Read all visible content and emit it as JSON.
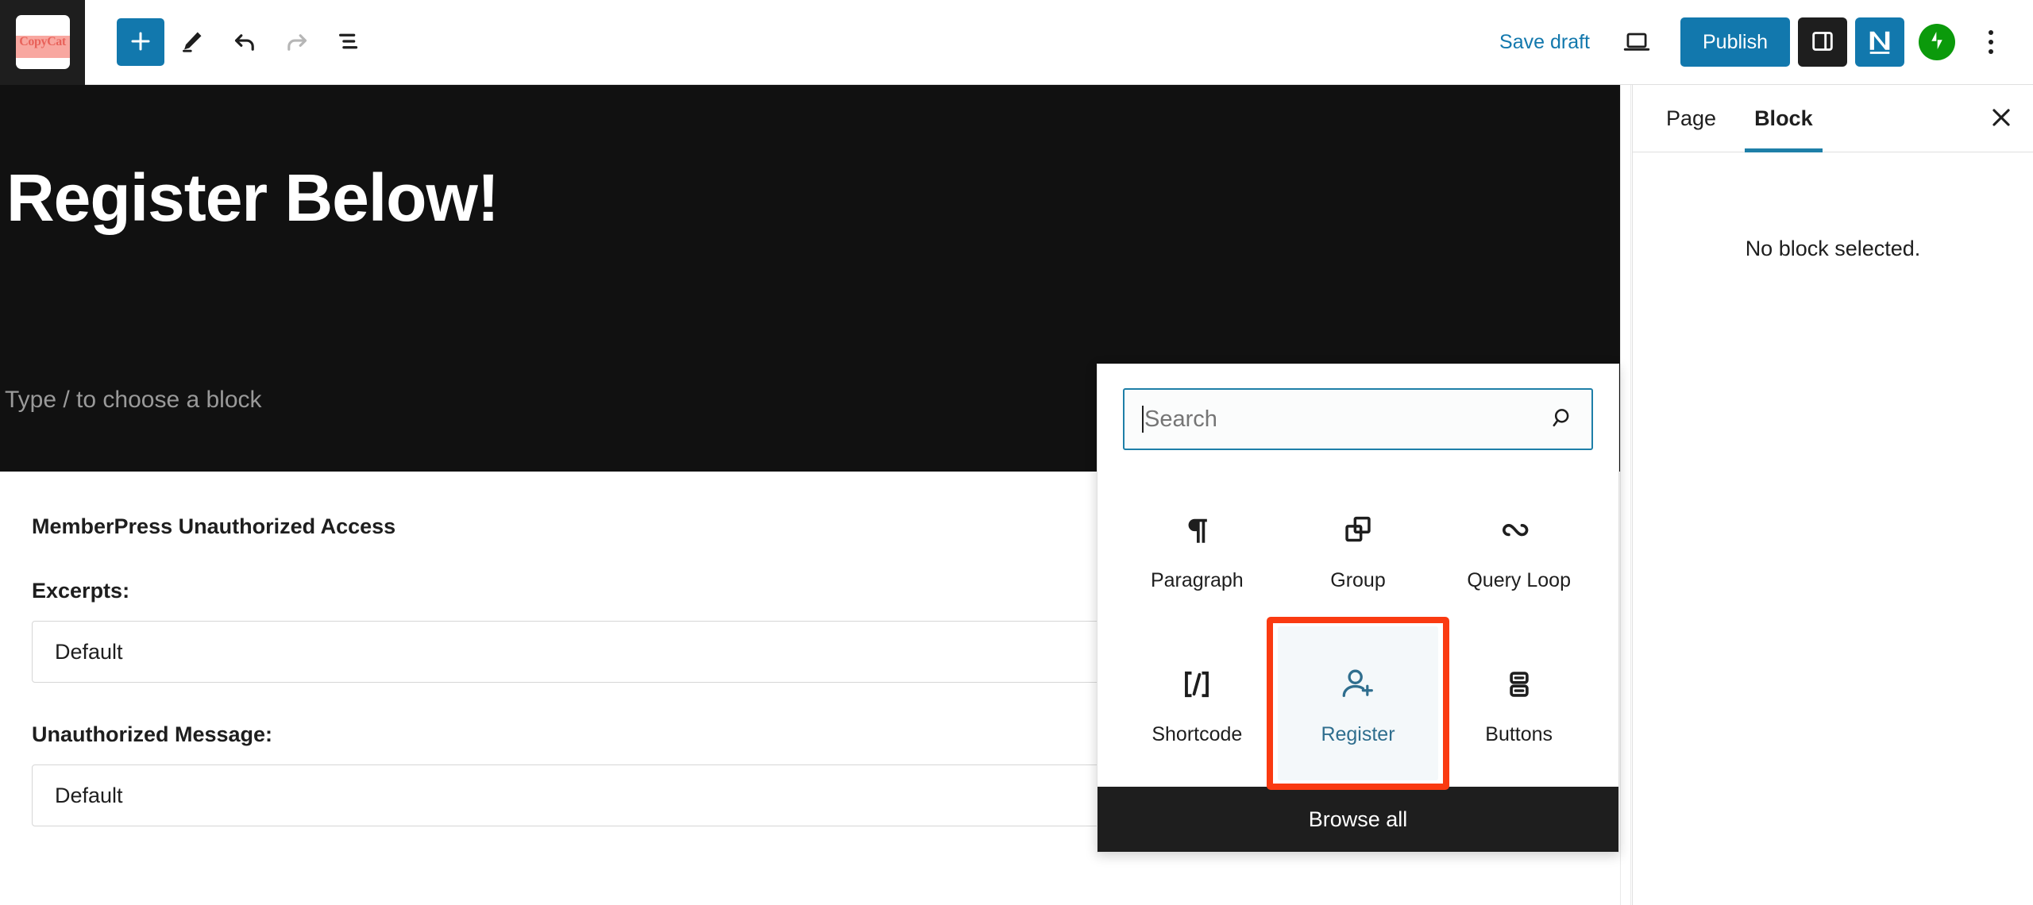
{
  "topbar": {
    "logo_text": "CopyCat",
    "logo_name": "site-logo",
    "left_tools": [
      {
        "name": "add-block-button",
        "icon": "plus-icon",
        "label": "Add block",
        "state": "enabled"
      },
      {
        "name": "tools-button",
        "icon": "pencil-icon",
        "label": "Tools",
        "state": "enabled"
      },
      {
        "name": "undo-button",
        "icon": "undo-icon",
        "label": "Undo",
        "state": "enabled"
      },
      {
        "name": "redo-button",
        "icon": "redo-icon",
        "label": "Redo",
        "state": "disabled"
      },
      {
        "name": "list-view-button",
        "icon": "list-view-icon",
        "label": "Document Overview",
        "state": "enabled"
      }
    ],
    "save_draft_label": "Save draft",
    "preview_label": "Preview",
    "publish_label": "Publish",
    "settings_label": "Settings",
    "nelio_label": "N",
    "jetpack_label": "Jetpack",
    "options_label": "Options"
  },
  "editor": {
    "post_title": "Register Below!",
    "block_placeholder": "Type / to choose a block",
    "appender_label": "Add block",
    "memberpress": {
      "heading": "MemberPress Unauthorized Access",
      "fields": [
        {
          "label": "Excerpts:",
          "value": "Default"
        },
        {
          "label": "Unauthorized Message:",
          "value": "Default"
        }
      ]
    }
  },
  "inserter": {
    "search_placeholder": "Search",
    "search_value": "",
    "blocks": [
      {
        "label": "Paragraph",
        "icon": "paragraph-icon",
        "selected": false
      },
      {
        "label": "Group",
        "icon": "group-icon",
        "selected": false
      },
      {
        "label": "Query Loop",
        "icon": "query-loop-icon",
        "selected": false
      },
      {
        "label": "Shortcode",
        "icon": "shortcode-icon",
        "selected": false
      },
      {
        "label": "Register",
        "icon": "register-user-icon",
        "selected": true
      },
      {
        "label": "Buttons",
        "icon": "buttons-icon",
        "selected": false
      }
    ],
    "browse_all_label": "Browse all"
  },
  "sidebar": {
    "tabs": [
      {
        "label": "Page",
        "active": false
      },
      {
        "label": "Block",
        "active": true
      }
    ],
    "close_label": "Close settings",
    "empty_message": "No block selected."
  },
  "colors": {
    "accent_blue": "#1278ad",
    "focus_teal": "#1e7fa8",
    "annotation_red": "#fa3a11",
    "register_blue": "#2f6e8e",
    "jetpack_green": "#0b9a0b",
    "dark_canvas": "#111111"
  }
}
